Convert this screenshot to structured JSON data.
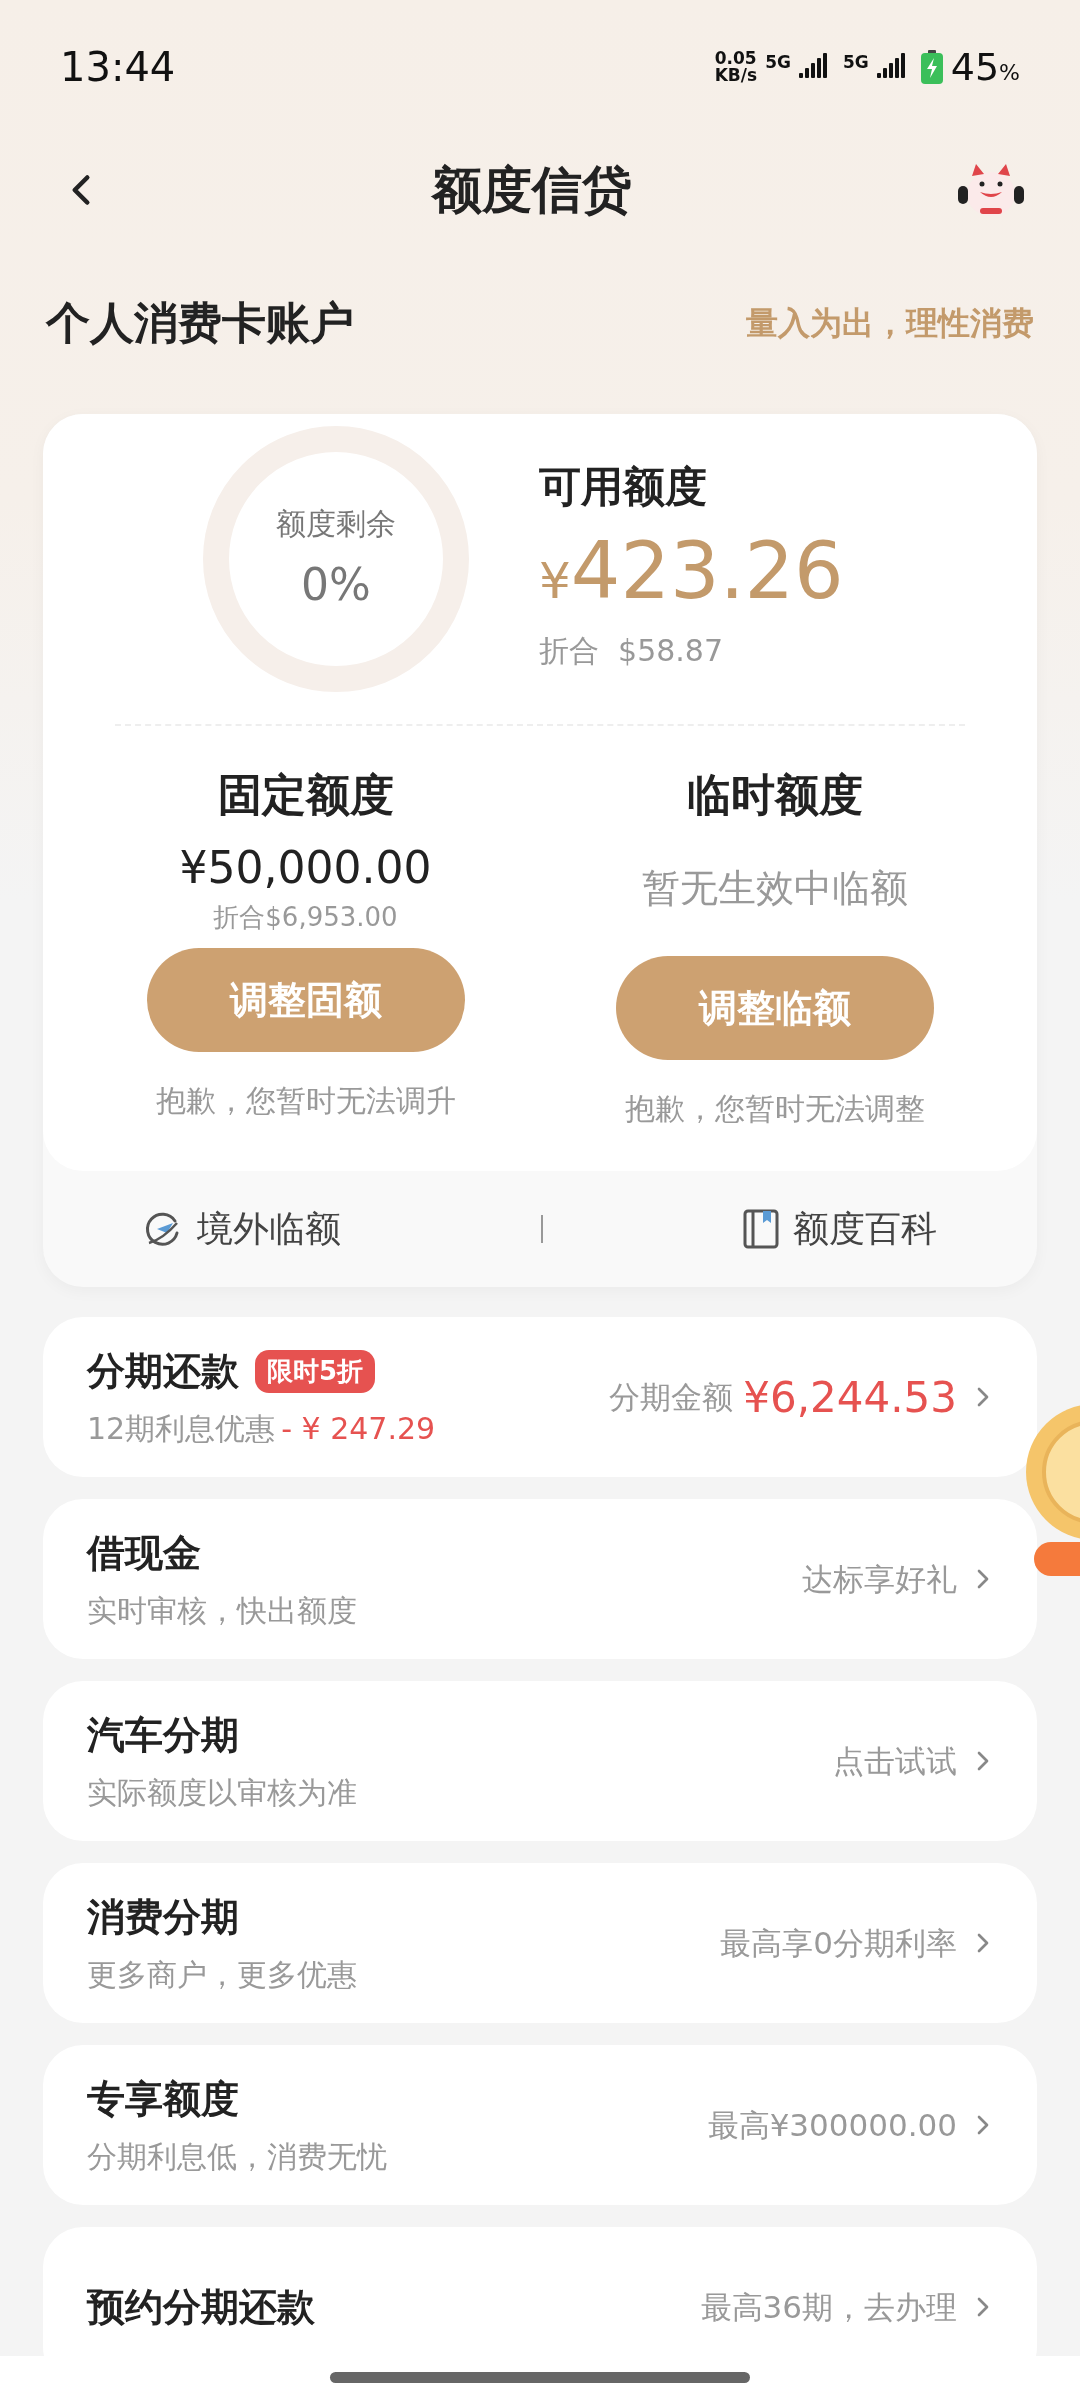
{
  "status_bar": {
    "time": "13:44",
    "net_speed": "0.05\nKB/s",
    "sim1": "5G",
    "sim2": "5G",
    "battery": "45",
    "battery_unit": "%"
  },
  "header": {
    "title": "额度信贷"
  },
  "account": {
    "title": "个人消费卡账户",
    "slogan": "量入为出，理性消费"
  },
  "summary": {
    "ring_label": "额度剩余",
    "ring_value": "0%",
    "level": 0,
    "available_label": "可用额度",
    "currency": "¥",
    "available_amount": "423.26",
    "converted": "折合  $58.87"
  },
  "limits": [
    {
      "title": "固定额度",
      "amount": "¥50,000.00",
      "note": "折合$6,953.00",
      "button": "调整固额",
      "hint": "抱歉，您暂时无法调升"
    },
    {
      "title": "临时额度",
      "status": "暂无生效中临额",
      "button": "调整临额",
      "hint": "抱歉，您暂时无法调整"
    }
  ],
  "shortcuts": [
    {
      "label": "境外临额",
      "kind": "plane"
    },
    {
      "label": "额度百科",
      "kind": "book"
    }
  ],
  "services": [
    {
      "title": "分期还款",
      "tag": "限时5折",
      "subtitle": "12期利息优惠",
      "discount": "- ¥ 247.29",
      "right_label": "分期金额",
      "right_value": "¥6,244.53"
    },
    {
      "title": "借现金",
      "subtitle": "实时审核，快出额度",
      "right_label": "达标享好礼"
    },
    {
      "title": "汽车分期",
      "subtitle": "实际额度以审核为准",
      "right_label": "点击试试"
    },
    {
      "title": "消费分期",
      "subtitle": "更多商户，更多优惠",
      "right_label": "最高享0分期利率"
    },
    {
      "title": "专享额度",
      "subtitle": "分期利息低，消费无忧",
      "right_label": "最高¥300000.00"
    },
    {
      "title": "预约分期还款",
      "right_label": "最高36期，去办理"
    }
  ]
}
